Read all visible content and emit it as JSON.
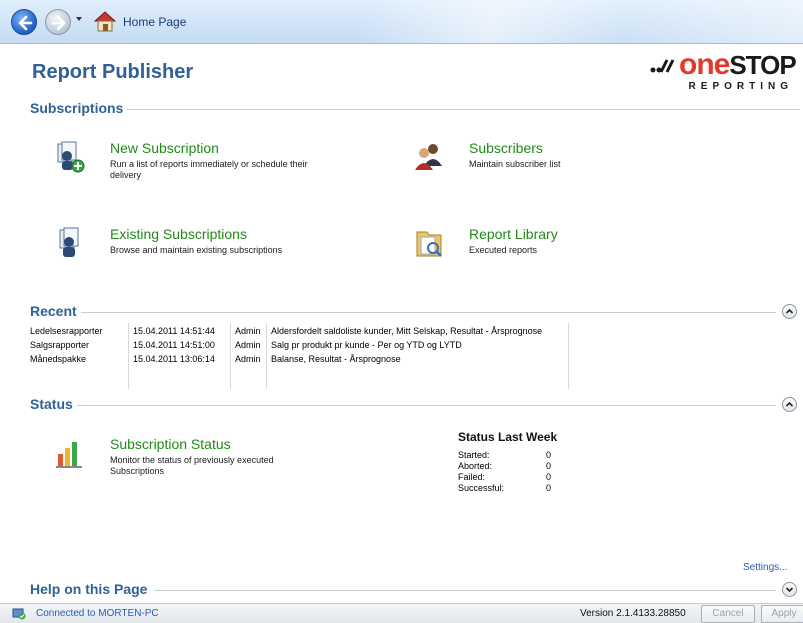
{
  "nav": {
    "breadcrumb": "Home Page"
  },
  "header": {
    "title": "Report Publisher",
    "logo": {
      "word_one": "one",
      "word_stop": "STOP",
      "sub": "REPORTING"
    }
  },
  "sections": {
    "subscriptions": "Subscriptions",
    "recent": "Recent",
    "status": "Status",
    "help": "Help on this Page"
  },
  "tasks": {
    "new_subscription": {
      "title": "New Subscription",
      "desc": "Run a list of reports immediately or schedule their delivery",
      "icon": "new-subscription-icon"
    },
    "subscribers": {
      "title": "Subscribers",
      "desc": "Maintain subscriber list",
      "icon": "subscribers-icon"
    },
    "existing_subscriptions": {
      "title": "Existing Subscriptions",
      "desc": "Browse and maintain existing subscriptions",
      "icon": "existing-subscriptions-icon"
    },
    "report_library": {
      "title": "Report Library",
      "desc": "Executed reports",
      "icon": "report-library-icon"
    },
    "subscription_status": {
      "title": "Subscription Status",
      "desc": "Monitor the status of previously executed Subscriptions",
      "icon": "status-chart-icon"
    }
  },
  "recent": [
    {
      "name": "Ledelsesrapporter",
      "time": "15.04.2011 14:51:44",
      "user": "Admin",
      "reports": "Aldersfordelt saldoliste kunder, Mitt Selskap, Resultat - Årsprognose"
    },
    {
      "name": "Salgsrapporter",
      "time": "15.04.2011 14:51:00",
      "user": "Admin",
      "reports": "Salg pr produkt pr kunde - Per og YTD og LYTD"
    },
    {
      "name": "Månedspakke",
      "time": "15.04.2011 13:06:14",
      "user": "Admin",
      "reports": "Balanse, Resultat - Årsprognose"
    }
  ],
  "status_last_week": {
    "title": "Status Last Week",
    "rows": [
      {
        "label": "Started:",
        "value": "0"
      },
      {
        "label": "Aborted:",
        "value": "0"
      },
      {
        "label": "Failed:",
        "value": "0"
      },
      {
        "label": "Successful:",
        "value": "0"
      }
    ]
  },
  "settings_link": "Settings...",
  "statusbar": {
    "connection": "Connected to MORTEN-PC",
    "version": "Version 2.1.4133.28850",
    "cancel": "Cancel",
    "apply": "Apply"
  },
  "colors": {
    "title_blue": "#2f6096",
    "link_green": "#218a17",
    "accent_red": "#e23a2a"
  }
}
